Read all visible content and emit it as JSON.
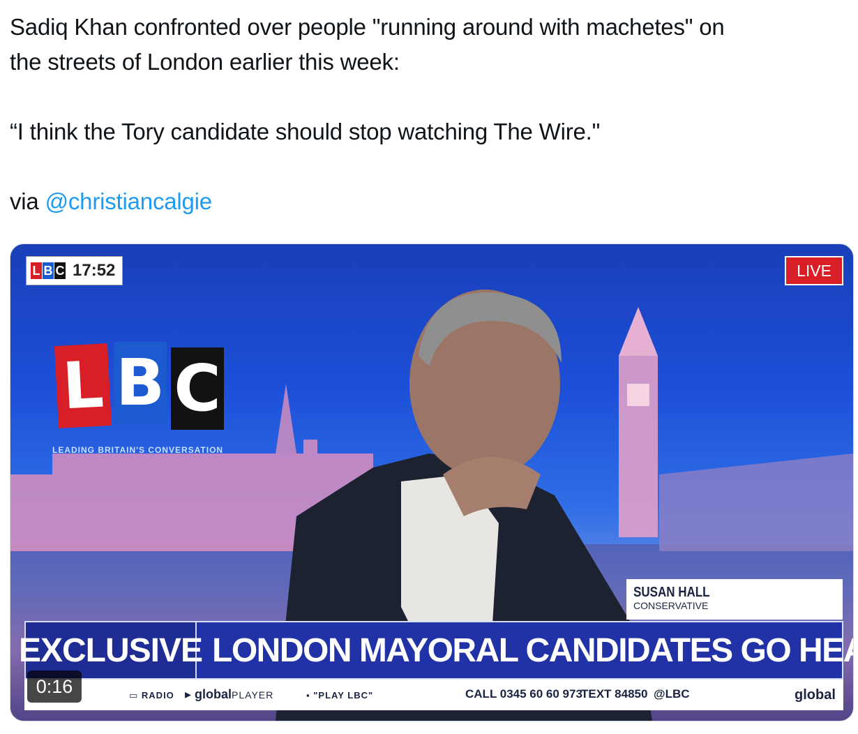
{
  "tweet": {
    "line1": "Sadiq Khan confronted over people \"running around with machetes\" on",
    "line2": "the streets of London earlier this week:",
    "quote": "“I think the Tory candidate should stop watching The Wire.\"",
    "via_prefix": "via ",
    "mention": "@christiancalgie"
  },
  "video": {
    "channel_logo": "LBC",
    "clock": "17:52",
    "live_badge": "LIVE",
    "big_logo_letters": [
      "L",
      "B",
      "C"
    ],
    "tagline": "LEADING BRITAIN'S CONVERSATION",
    "namecard": {
      "name": "SUSAN HALL",
      "party": "CONSERVATIVE"
    },
    "lower_third": {
      "label": "EXCLUSIVE",
      "headline": "LONDON MAYORAL CANDIDATES GO HEAD-TO-HEAD"
    },
    "ticker": {
      "radio": "RADIO",
      "global_player_a": "global",
      "global_player_b": "PLAYER",
      "play": "\"PLAY LBC\"",
      "call": "CALL 0345 60 60 973",
      "text": "TEXT 84850",
      "handle": "@LBC",
      "brand": "global"
    },
    "elapsed": "0:16"
  },
  "colors": {
    "mention": "#1d9bf0",
    "lbc_red": "#d81e27",
    "lbc_blue": "#1c5ad0",
    "banner_blue": "#2132a6"
  }
}
